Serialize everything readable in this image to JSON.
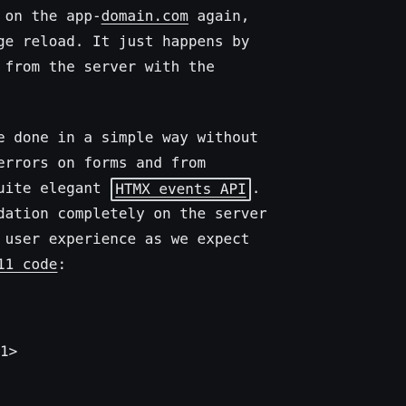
{
  "paragraph1": {
    "line1_pre": " on the app-",
    "line1_link": "domain.com",
    "line1_post": " again,",
    "line2": "ge reload. It just happens by",
    "line3": " from the server with the"
  },
  "paragraph2": {
    "line1": "e done in a simple way without",
    "line2": "errors on forms and from",
    "line3_pre": "uite elegant ",
    "line3_highlight": "HTMX events API",
    "line3_post": ".",
    "line4": "dation completely on the server",
    "line5": " user experience as we expect",
    "line6_code": "11 code",
    "line6_post": ":"
  },
  "footer": {
    "code_tail": "1>"
  }
}
